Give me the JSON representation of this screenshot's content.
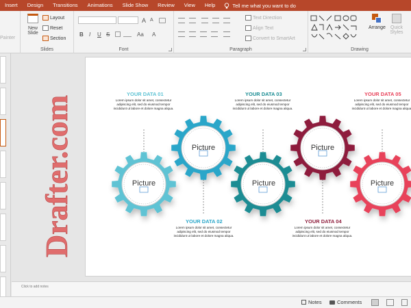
{
  "tabs": [
    "Insert",
    "Design",
    "Transitions",
    "Animations",
    "Slide Show",
    "Review",
    "View",
    "Help"
  ],
  "tell_me": "Tell me what you want to do",
  "ribbon": {
    "clipboard_partial": "Painter",
    "slides": {
      "new_slide": "New",
      "new_slide_2": "Slide",
      "layout": "Layout",
      "reset": "Reset",
      "section": "Section",
      "label": "Slides"
    },
    "font": {
      "label": "Font",
      "bold": "B",
      "italic": "I",
      "underline": "U",
      "strike": "S",
      "grow": "A",
      "shrink": "A",
      "aa": "Aa",
      "clear": "A"
    },
    "paragraph": {
      "label": "Paragraph",
      "text_direction": "Text Direction",
      "align_text": "Align Text",
      "convert": "Convert to SmartArt"
    },
    "drawing": {
      "label": "Drawing",
      "arrange": "Arrange",
      "quick_styles": "Quick",
      "quick_styles_2": "Styles"
    }
  },
  "slide": {
    "items": [
      {
        "heading": "YOUR DATA 01",
        "body": "Lorem ipsum dolor sit amet, consectetur adipiscing elit, sed do eiusmod tempor incididunt ut labore et dolore magna aliqua.",
        "picture": "Picture",
        "color": "#5fc3d4"
      },
      {
        "heading": "YOUR DATA 02",
        "body": "Lorem ipsum dolor sit amet, consectetur adipiscing elit, sed do eiusmod tempor incididunt ut labore et dolore magna aliqua.",
        "picture": "Picture",
        "color": "#2aa6c9"
      },
      {
        "heading": "YOUR DATA 03",
        "body": "Lorem ipsum dolor sit amet, consectetur adipiscing elit, sed do eiusmod tempor incididunt ut labore et dolore magna aliqua.",
        "picture": "Picture",
        "color": "#1a8c93"
      },
      {
        "heading": "YOUR DATA 04",
        "body": "Lorem ipsum dolor sit amet, consectetur adipiscing elit, sed do eiusmod tempor incididunt ut labore et dolore magna aliqua.",
        "picture": "Picture",
        "color": "#8e1d3c"
      },
      {
        "heading": "YOUR DATA 05",
        "body": "Lorem ipsum dolor sit amet, consectetur adipiscing elit, sed do eiusmod tempor incididunt ut labore et dolore magna aliqua.",
        "picture": "Picture",
        "color": "#e8425a"
      }
    ],
    "heading_colors": [
      "#5fc3d4",
      "#2aa6c9",
      "#1a8c93",
      "#8e1d3c",
      "#e8425a"
    ]
  },
  "watermark": "Drafter.com",
  "notes_placeholder": "Click to add notes",
  "status": {
    "notes": "Notes",
    "comments": "Comments"
  },
  "colors": {
    "ribbon_accent": "#b7472a",
    "watermark": "#e06d6d"
  }
}
